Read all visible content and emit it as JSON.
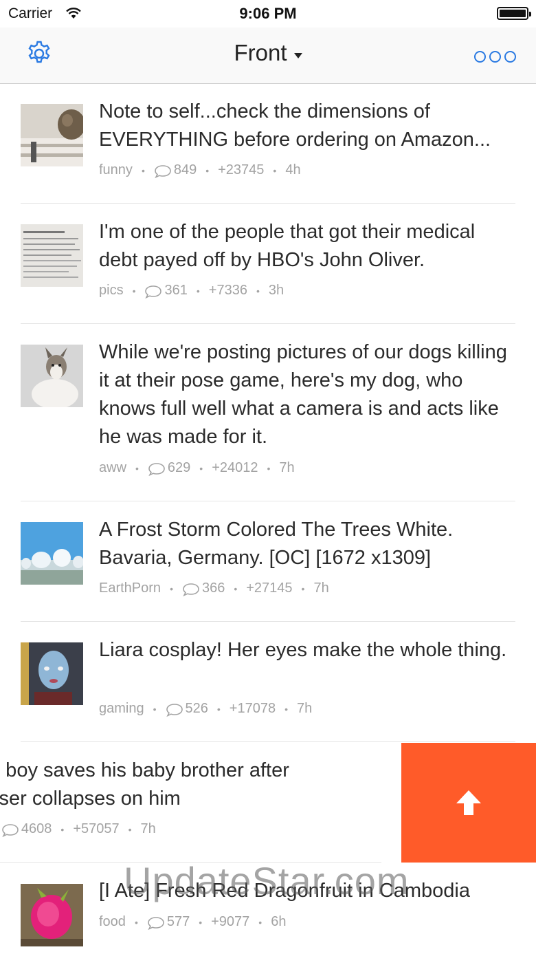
{
  "status_bar": {
    "carrier": "Carrier",
    "time": "9:06 PM"
  },
  "nav": {
    "title": "Front",
    "settings_icon": "gear-icon",
    "more_icon": "more-icon",
    "accent_color": "#2a7ae2"
  },
  "posts": [
    {
      "title": "Note to self...check the dimensions of EVERYTHING before ordering on Amazon...",
      "subreddit": "funny",
      "comments": "849",
      "score": "+23745",
      "age": "4h"
    },
    {
      "title": "I'm one of the people that got their medical debt payed off by HBO's John Oliver.",
      "subreddit": "pics",
      "comments": "361",
      "score": "+7336",
      "age": "3h"
    },
    {
      "title": "While we're posting pictures of our dogs killing it at their pose game, here's my dog, who knows full well what a camera is and acts like he was made for it.",
      "subreddit": "aww",
      "comments": "629",
      "score": "+24012",
      "age": "7h"
    },
    {
      "title": "A Frost Storm Colored The Trees White. Bavaria, Germany. [OC] [1672 x1309]",
      "subreddit": "EarthPorn",
      "comments": "366",
      "score": "+27145",
      "age": "7h"
    },
    {
      "title": "Liara cosplay! Her eyes make the whole thing.",
      "subreddit": "gaming",
      "comments": "526",
      "score": "+17078",
      "age": "7h"
    },
    {
      "title_line1": "e boy saves his baby brother after",
      "title_line2": "sser collapses on him",
      "comments": "4608",
      "score": "+57057",
      "age": "7h"
    },
    {
      "title": "[I Ate] Fresh Red Dragonfruit in Cambodia",
      "subreddit": "food",
      "comments": "577",
      "score": "+9077",
      "age": "6h"
    }
  ],
  "swipe_action": {
    "icon": "upvote-arrow-icon",
    "color": "#ff5b29"
  },
  "watermark": "UpdateStar.com"
}
